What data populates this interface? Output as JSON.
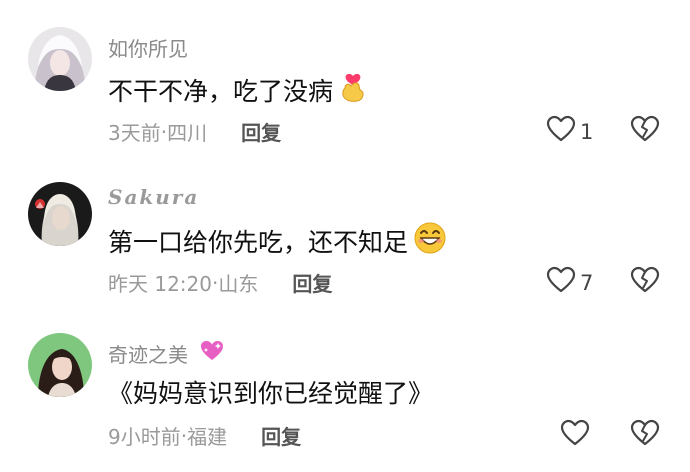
{
  "comments": [
    {
      "username": "如你所见",
      "text": "不干不净，吃了没病",
      "emoji_icon": "finger-heart-emoji",
      "time": "3天前",
      "location": "四川",
      "reply_label": "回复",
      "like_count": "1"
    },
    {
      "username": "Sakura",
      "text": "第一口给你先吃，还不知足",
      "emoji_icon": "grinning-face-emoji",
      "time": "昨天 12:20",
      "location": "山东",
      "reply_label": "回复",
      "like_count": "7"
    },
    {
      "username": "奇迹之美",
      "badge_icon": "sparkling-heart-icon",
      "text": "《妈妈意识到你已经觉醒了》",
      "time": "9小时前",
      "location": "福建",
      "reply_label": "回复",
      "like_count": ""
    }
  ],
  "separator": " · ",
  "colors": {
    "background": "#ffffff",
    "username": "#8a8a8a",
    "text": "#111111",
    "meta": "#9a9a9a",
    "icon": "#444444"
  }
}
